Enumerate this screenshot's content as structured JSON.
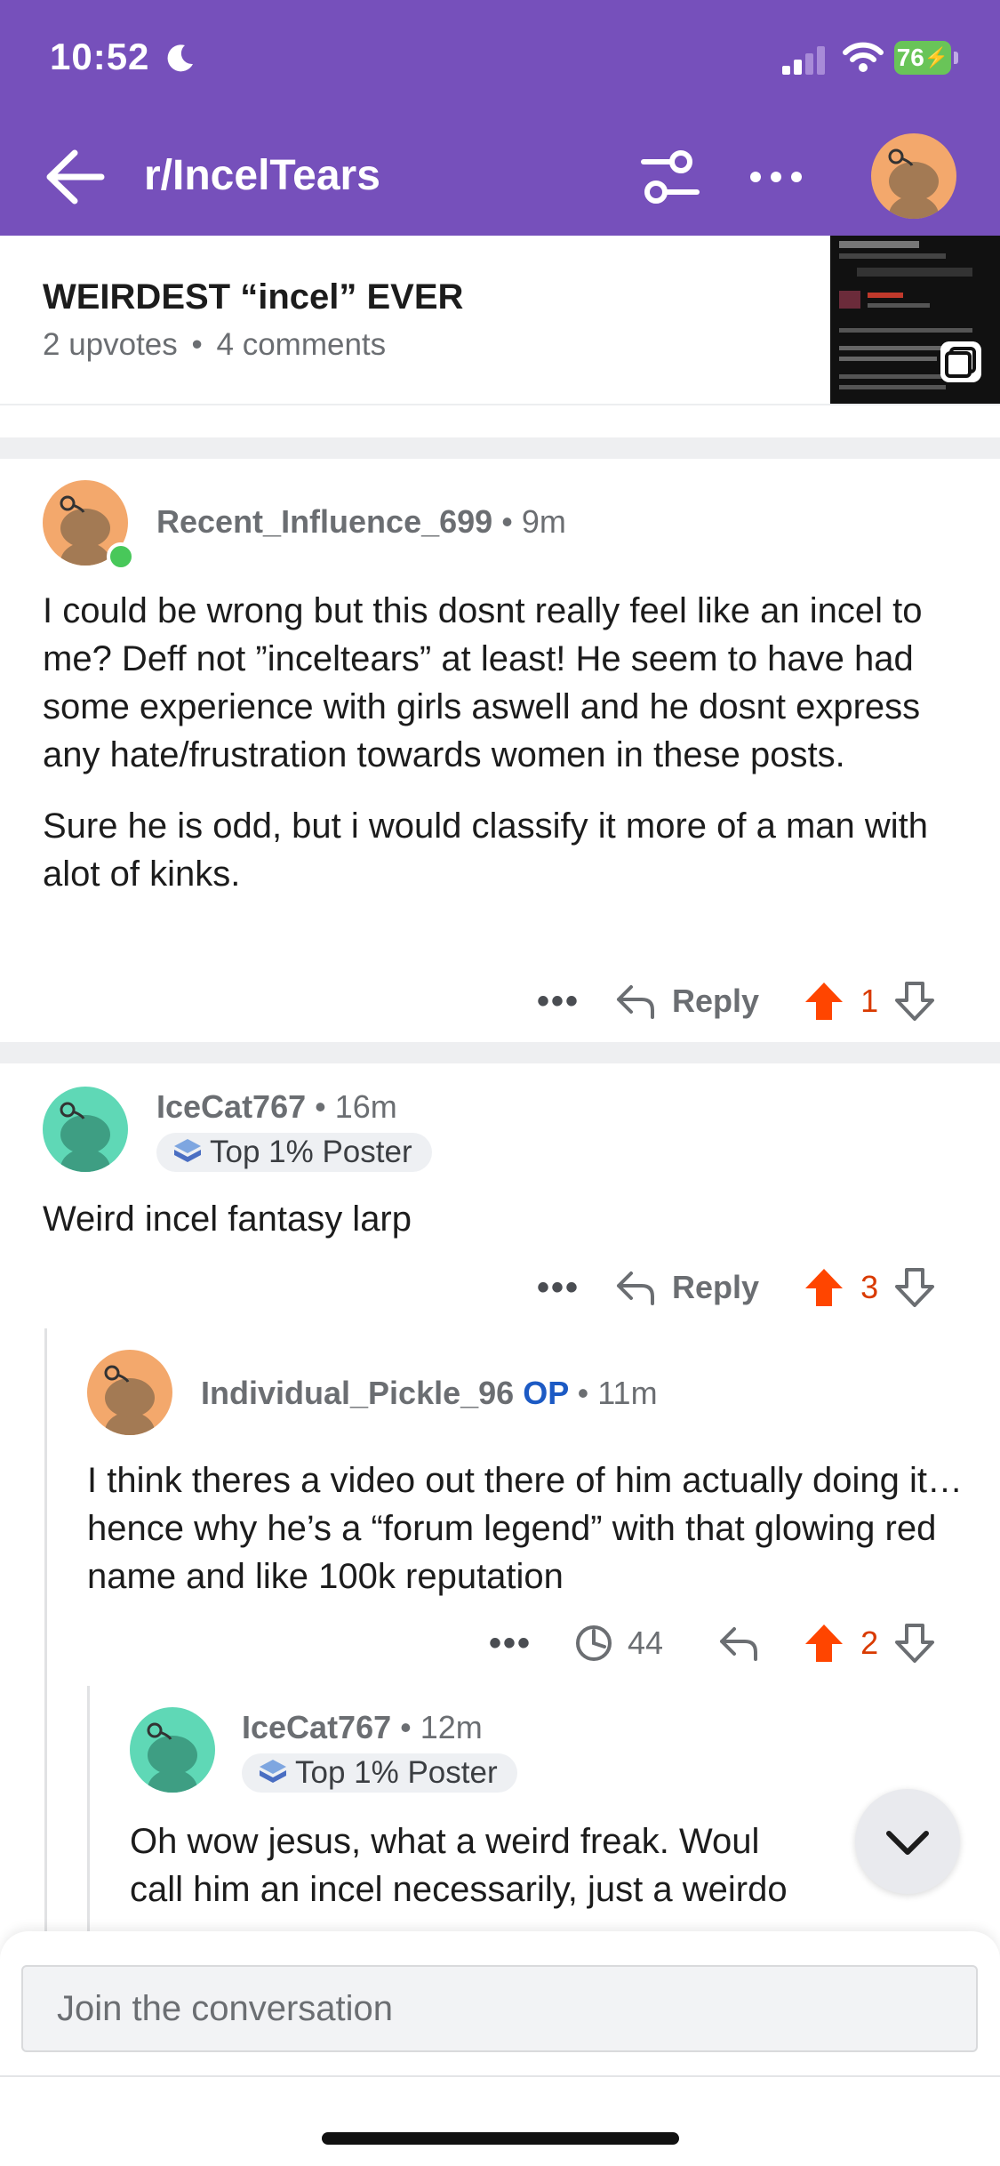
{
  "status_bar": {
    "time": "10:52",
    "battery": "76"
  },
  "header": {
    "subreddit": "r/IncelTears",
    "accent_color": "#7650bb"
  },
  "post": {
    "title": "WEIRDEST “incel” EVER",
    "upvotes": "2 upvotes",
    "bullet": "•",
    "comments": "4 comments"
  },
  "comments": [
    {
      "username": "Recent_Influence_699",
      "time": "9m",
      "paragraphs": [
        "I could be wrong but this dosnt really feel like an incel to me? Deff not ”inceltears” at least! He seem to have had some experience with girls aswell and he dosnt express any hate/frustration towards women in these posts.",
        "Sure he is odd, but i would classify it more of a man with alot of kinks."
      ],
      "reply_label": "Reply",
      "votes": "1"
    },
    {
      "username": "IceCat767",
      "time": "16m",
      "flair": "Top 1% Poster",
      "paragraphs": [
        "Weird incel fantasy larp"
      ],
      "reply_label": "Reply",
      "votes": "3"
    },
    {
      "username": "Individual_Pickle_96",
      "op_badge": "OP",
      "time": "11m",
      "paragraphs": [
        "I think theres a video out there of him actually doing it… hence why he’s a “forum legend” with that glowing red name and like 100k reputation"
      ],
      "award_count": "44",
      "votes": "2"
    },
    {
      "username": "IceCat767",
      "time": "12m",
      "flair": "Top 1% Poster",
      "paragraphs": [
        "Oh wow jesus, what a weird freak. Woul",
        "call him an incel necessarily, just a weirdo"
      ]
    }
  ],
  "composer": {
    "placeholder": "Join the conversation"
  },
  "colors": {
    "upvote": "#ff4500",
    "vote_text": "#d93a00",
    "op": "#1c5ac4"
  }
}
